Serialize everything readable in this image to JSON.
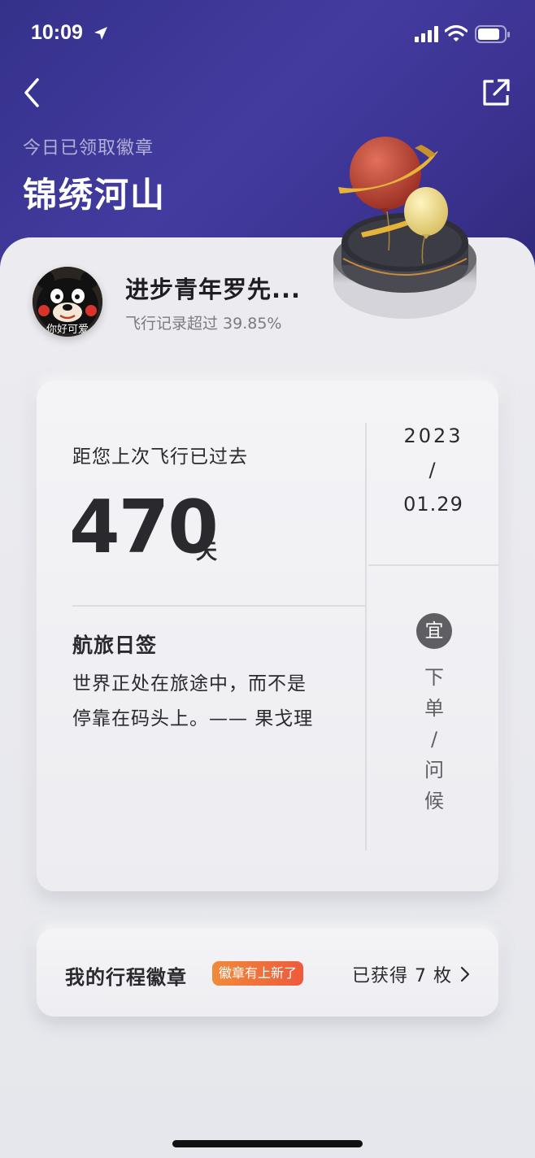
{
  "status_bar": {
    "time": "10:09",
    "icons": [
      "location-arrow-icon",
      "cellular-signal-icon",
      "wifi-icon",
      "battery-icon"
    ]
  },
  "header": {
    "back_icon": "chevron-left-icon",
    "share_icon": "share-external-icon",
    "subtitle": "今日已领取徽章",
    "title": "锦绣河山",
    "badge_image": "balloon-platform-badge"
  },
  "profile": {
    "avatar_caption": "你好可爱",
    "name": "进步青年罗先...",
    "stat": "飞行记录超过 39.85%"
  },
  "flight_card": {
    "since_label": "距您上次飞行已过去",
    "days": "470",
    "days_unit": "天",
    "date_year": "2023",
    "date_slash": "/",
    "date_md": "01.29",
    "quote_title": "航旅日签",
    "quote_text": "世界正处在旅途中，而不是停靠在码头上。—— 果戈理",
    "yi_label": "宜",
    "yi_items": [
      "下",
      "单",
      "/",
      "问",
      "候"
    ]
  },
  "badges": {
    "title": "我的行程徽章",
    "new_tag": "徽章有上新了",
    "count": "已获得 7 枚",
    "chevron_icon": "chevron-right-icon"
  },
  "colors": {
    "header_bg": "#3e3896",
    "new_tag_orange": "#f08a3a",
    "new_tag_red": "#ee5a3c",
    "yi_badge": "#5e5e63"
  }
}
